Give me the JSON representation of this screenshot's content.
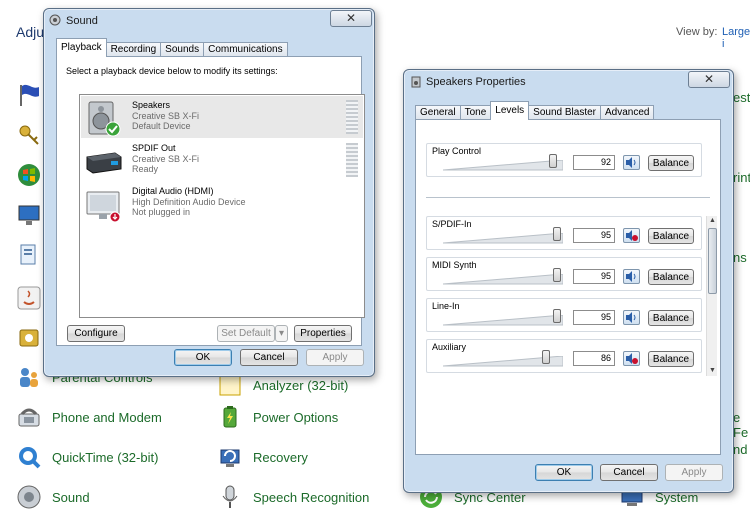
{
  "control_panel": {
    "header_text": "Adju",
    "view_by_label": "View by:",
    "view_by_value": "Large i",
    "items_visible": [
      {
        "label": "Parental Controls",
        "icon": "parental-controls-icon"
      },
      {
        "label": "Analyzer (32-bit)",
        "icon": "analyzer-icon"
      },
      {
        "label": "Phone and Modem",
        "icon": "phone-modem-icon"
      },
      {
        "label": "Power Options",
        "icon": "power-options-icon"
      },
      {
        "label": "QuickTime (32-bit)",
        "icon": "quicktime-icon"
      },
      {
        "label": "Recovery",
        "icon": "recovery-icon"
      },
      {
        "label": "Sound",
        "icon": "sound-icon"
      },
      {
        "label": "Speech Recognition",
        "icon": "microphone-icon"
      },
      {
        "label": "Sync Center",
        "icon": "sync-center-icon"
      },
      {
        "label": "System",
        "icon": "system-icon"
      }
    ],
    "right_edge_fragments": [
      "esto",
      "rint",
      "ns",
      "e Fe",
      "nd"
    ]
  },
  "sound_window": {
    "title": "Sound",
    "close_glyph": "✕",
    "tabs": [
      "Playback",
      "Recording",
      "Sounds",
      "Communications"
    ],
    "active_tab": "Playback",
    "instruction": "Select a playback device below to modify its settings:",
    "devices": [
      {
        "name": "Speakers",
        "driver": "Creative SB X-Fi",
        "status": "Default Device",
        "selected": true,
        "icon": "speakers-icon"
      },
      {
        "name": "SPDIF Out",
        "driver": "Creative SB X-Fi",
        "status": "Ready",
        "selected": false,
        "icon": "spdif-device-icon"
      },
      {
        "name": "Digital Audio (HDMI)",
        "driver": "High Definition Audio Device",
        "status": "Not plugged in",
        "selected": false,
        "icon": "hdmi-monitor-icon"
      }
    ],
    "buttons": {
      "configure": "Configure",
      "set_default": "Set Default",
      "properties": "Properties",
      "ok": "OK",
      "cancel": "Cancel",
      "apply": "Apply"
    }
  },
  "speakers_properties": {
    "title": "Speakers Properties",
    "close_glyph": "✕",
    "tabs": [
      "General",
      "Tone",
      "Levels",
      "Sound Blaster",
      "Advanced"
    ],
    "active_tab": "Levels",
    "master": {
      "label": "Play Control",
      "value": "92",
      "level": 0.92,
      "muted": false
    },
    "channels": [
      {
        "label": "S/PDIF-In",
        "value": "95",
        "level": 0.95,
        "muted": true
      },
      {
        "label": "MIDI Synth",
        "value": "95",
        "level": 0.95,
        "muted": false
      },
      {
        "label": "Line-In",
        "value": "95",
        "level": 0.95,
        "muted": false
      },
      {
        "label": "Auxiliary",
        "value": "86",
        "level": 0.86,
        "muted": true
      }
    ],
    "balance_label": "Balance",
    "buttons": {
      "ok": "OK",
      "cancel": "Cancel",
      "apply": "Apply"
    }
  },
  "colors": {
    "link_green": "#1c6b2a",
    "window_frame": "#c9dcef",
    "selection": "#e8e8e8",
    "mute_red": "#c8102e"
  }
}
